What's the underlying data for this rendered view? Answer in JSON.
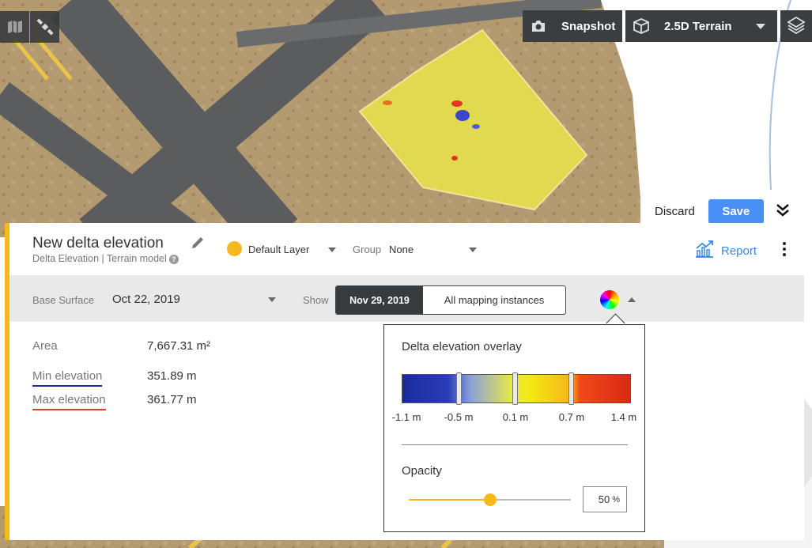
{
  "toolbar": {
    "snapshot_label": "Snapshot",
    "terrain_label": "2.5D Terrain"
  },
  "savebar": {
    "discard_label": "Discard",
    "save_label": "Save"
  },
  "panel": {
    "title": "New delta elevation",
    "subtitle": "Delta Elevation | Terrain model",
    "layer": "Default Layer",
    "group_label": "Group",
    "group_value": "None",
    "report_label": "Report",
    "base_surface_label": "Base Surface",
    "base_surface_value": "Oct 22, 2019",
    "show_label": "Show",
    "show_options": [
      "Nov 29, 2019",
      "All mapping instances"
    ],
    "stats": [
      {
        "label": "Area",
        "value": "7,667.31 m²"
      },
      {
        "label": "Min elevation",
        "value": "351.89 m"
      },
      {
        "label": "Max elevation",
        "value": "361.77 m"
      }
    ]
  },
  "overlay": {
    "title": "Delta elevation overlay",
    "ticks": [
      "-1.1 m",
      "-0.5 m",
      "0.1 m",
      "0.7 m",
      "1.4 m"
    ],
    "opacity_label": "Opacity",
    "opacity_value": "50",
    "opacity_unit": "%",
    "opacity_fraction": 0.5
  },
  "colors": {
    "accent": "#f6b81a",
    "primary": "#4a8ff5",
    "link": "#3a86e8",
    "dark": "#353b3e",
    "min_underline": "#1b2aa7",
    "max_underline": "#e23b2e"
  },
  "icons": [
    "map-icon",
    "satellite-icon",
    "camera-icon",
    "cube-icon",
    "layers-icon",
    "double-chevron-down-icon",
    "pencil-icon",
    "help-icon",
    "report-chart-icon",
    "more-vert-icon",
    "color-wheel-icon"
  ]
}
